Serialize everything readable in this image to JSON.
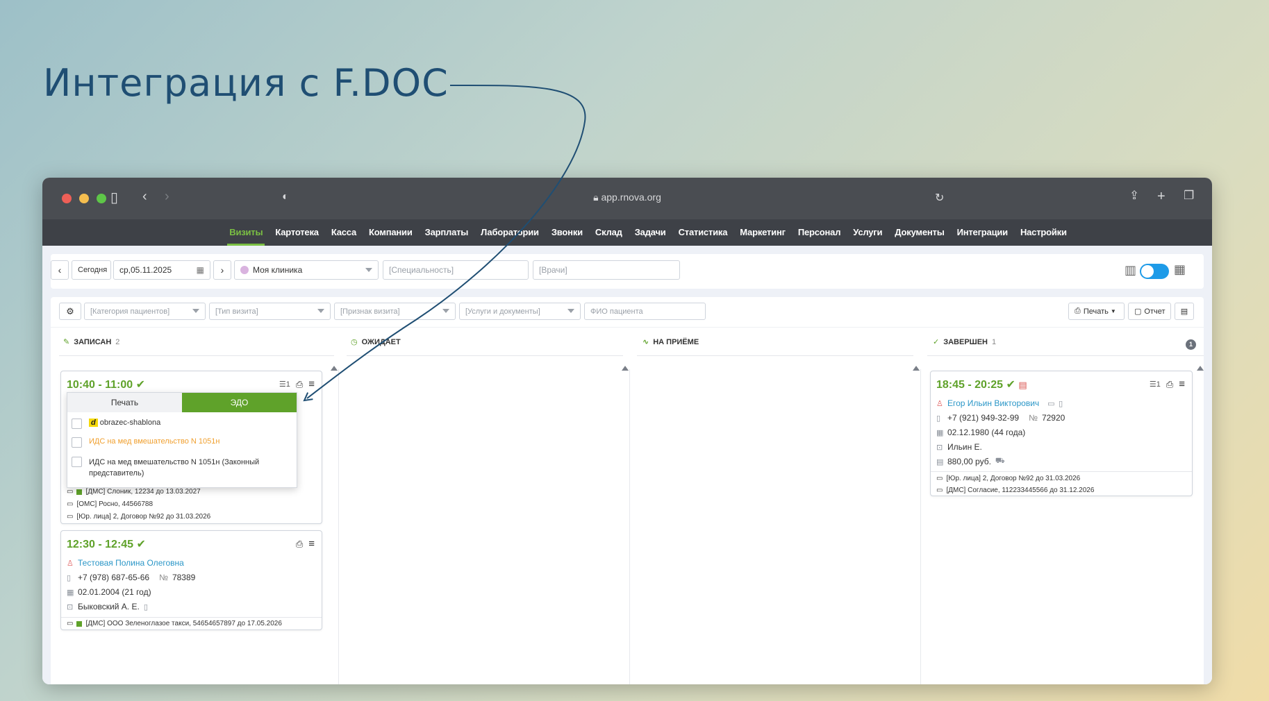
{
  "headline": "Интеграция с F.DOC",
  "browser": {
    "url": "app.rnova.org"
  },
  "nav": {
    "items": [
      "Визиты",
      "Картотека",
      "Касса",
      "Компании",
      "Зарплаты",
      "Лаборатории",
      "Звонки",
      "Склад",
      "Задачи",
      "Статистика",
      "Маркетинг",
      "Персонал",
      "Услуги",
      "Документы",
      "Интеграции",
      "Настройки"
    ],
    "active": "Визиты"
  },
  "toolbar": {
    "today": "Сегодня",
    "date": "ср,05.11.2025",
    "clinic": "Моя клиника",
    "specialty_placeholder": "[Специальность]",
    "doctors_placeholder": "[Врачи]"
  },
  "filters": {
    "patient_category": "[Категория пациентов]",
    "visit_type": "[Тип визита]",
    "visit_flag": "[Признак визита]",
    "services_docs": "[Услуги и документы]",
    "patient_name": "ФИО пациента",
    "print_label": "Печать",
    "report_label": "Отчет"
  },
  "columns": [
    {
      "title": "ЗАПИСАН",
      "count": "2"
    },
    {
      "title": "ОЖИДАЕТ",
      "count": ""
    },
    {
      "title": "НА ПРИЁМЕ",
      "count": ""
    },
    {
      "title": "ЗАВЕРШЕН",
      "count": "1"
    }
  ],
  "top_right_badge": "1",
  "cards": {
    "c1": {
      "time": "10:40 - 11:00",
      "list_count": "1",
      "policies": [
        "[ДМС] Слоник, 12234 до 13.03.2027",
        "[ОМС] Росно, 44566788",
        "[Юр. лица] 2, Договор №92 до 31.03.2026"
      ]
    },
    "c2": {
      "time": "12:30 - 12:45",
      "name": "Тестовая Полина Олеговна",
      "phone": "+7 (978) 687-65-66",
      "number_label": "№",
      "number": "78389",
      "birth": "02.01.2004 (21 год)",
      "doctor": "Быковский А. Е.",
      "policies": [
        "[ДМС] ООО Зеленоглазое такси, 54654657897 до 17.05.2026"
      ]
    },
    "c3": {
      "time": "18:45 - 20:25",
      "list_count": "1",
      "name": "Егор Ильин Викторович",
      "phone": "+7 (921) 949-32-99",
      "number_label": "№",
      "number": "72920",
      "birth": "02.12.1980 (44 года)",
      "doctor": "Ильин Е.",
      "amount": "880,00 руб.",
      "policies": [
        "[Юр. лица] 2, Договор №92 до 31.03.2026",
        "[ДМС] Согласие, 112233445566 до 31.12.2026"
      ]
    }
  },
  "popup": {
    "tab_print": "Печать",
    "tab_edo": "ЭДО",
    "logo_text": "d",
    "docs": [
      "obrazec-shablona",
      "ИДС на мед вмешательство N 1051н",
      "ИДС на мед вмешательство N 1051н (Законный представитель)"
    ]
  },
  "colors": {
    "accent_green": "#5fa22a",
    "nav_active": "#7bc043",
    "link_blue": "#2a96c7",
    "doc_orange": "#f0a030",
    "headline_blue": "#1f4e73"
  }
}
